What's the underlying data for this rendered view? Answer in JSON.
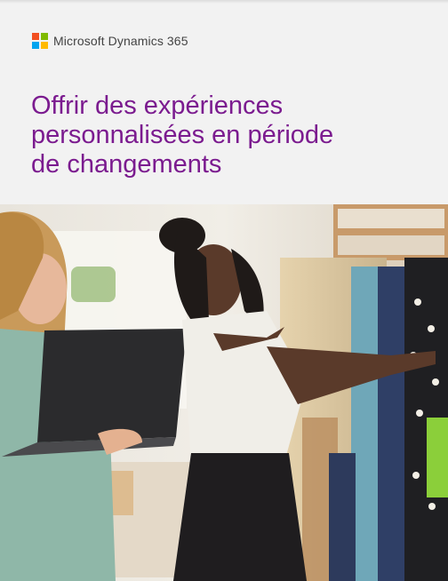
{
  "brand": {
    "name": "Microsoft Dynamics 365",
    "logo_colors": [
      "#f25022",
      "#7fba00",
      "#00a4ef",
      "#ffb900"
    ]
  },
  "headline": {
    "lines": [
      "Offrir des expériences",
      "personnalisées en période",
      "de changements"
    ],
    "color": "#7b1b8f"
  },
  "photo": {
    "subject": "store-clothing-rack-photo"
  }
}
